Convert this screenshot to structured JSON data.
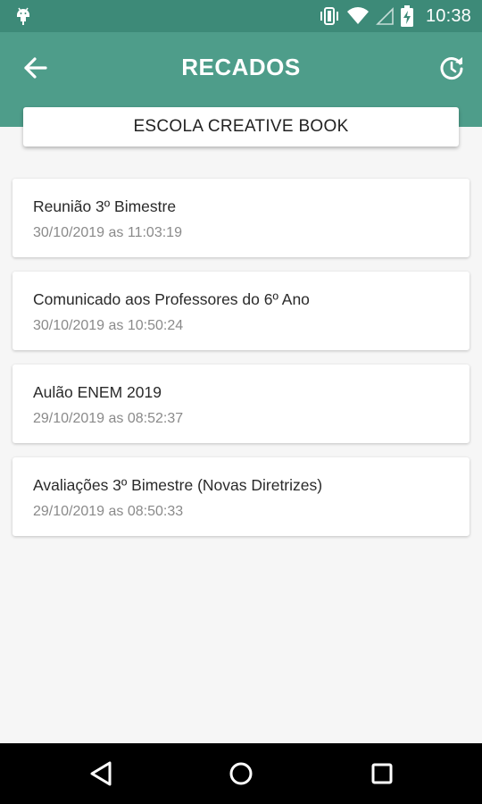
{
  "status_bar": {
    "time": "10:38",
    "icons": [
      "android-debug-icon",
      "vibrate-icon",
      "wifi-icon",
      "signal-icon",
      "battery-charging-icon"
    ]
  },
  "app_bar": {
    "title": "RECADOS",
    "back_icon": "arrow-left-icon",
    "refresh_icon": "refresh-icon",
    "background": "#4e9d8a",
    "status_bar_color": "#3d8a78"
  },
  "school": {
    "name": "ESCOLA CREATIVE BOOK"
  },
  "messages": [
    {
      "title": "Reunião 3º Bimestre",
      "date": "30/10/2019 as 11:03:19"
    },
    {
      "title": "Comunicado aos Professores do 6º Ano",
      "date": "30/10/2019 as 10:50:24"
    },
    {
      "title": "Aulão ENEM 2019",
      "date": "29/10/2019 as 08:52:37"
    },
    {
      "title": "Avaliações 3º Bimestre (Novas Diretrizes)",
      "date": "29/10/2019 as 08:50:33"
    }
  ],
  "nav_bar": {
    "icons": [
      "nav-back-icon",
      "nav-home-icon",
      "nav-recent-apps-icon"
    ]
  }
}
